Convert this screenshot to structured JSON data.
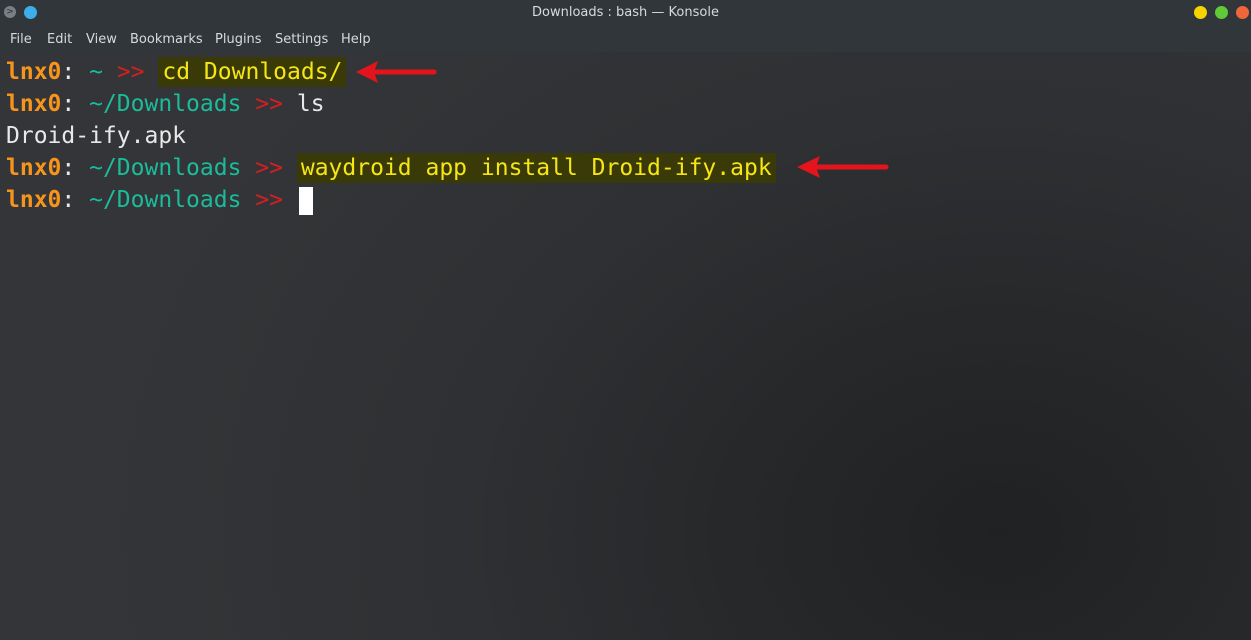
{
  "window": {
    "title": "Downloads : bash — Konsole",
    "app_icon": "konsole-icon",
    "controls": [
      {
        "name": "minimize",
        "color": "#f5d400"
      },
      {
        "name": "maximize",
        "color": "#5fc937"
      },
      {
        "name": "close",
        "color": "#f0663a"
      }
    ]
  },
  "menu": {
    "file": "File",
    "edit": "Edit",
    "view": "View",
    "bookmarks": "Bookmarks",
    "plugins": "Plugins",
    "settings": "Settings",
    "help": "Help"
  },
  "terminal": {
    "lines": [
      {
        "user": "lnx0",
        "sep": ":",
        "path": "~",
        "prompt": ">>",
        "command": "cd Downloads/",
        "highlighted": true
      },
      {
        "user": "lnx0",
        "sep": ":",
        "path": "~/Downloads",
        "prompt": ">>",
        "command": "ls",
        "highlighted": false
      },
      {
        "output": "Droid-ify.apk"
      },
      {
        "user": "lnx0",
        "sep": ":",
        "path": "~/Downloads",
        "prompt": ">>",
        "command": "waydroid app install Droid-ify.apk",
        "highlighted": true
      },
      {
        "user": "lnx0",
        "sep": ":",
        "path": "~/Downloads",
        "prompt": ">>",
        "command": "",
        "cursor": true
      }
    ]
  },
  "colors": {
    "user": "#f7941d",
    "path": "#1abc9c",
    "prompt_arrows": "#d81e1e",
    "highlight_text": "#f5e614",
    "annotation_arrow": "#e3141b"
  }
}
